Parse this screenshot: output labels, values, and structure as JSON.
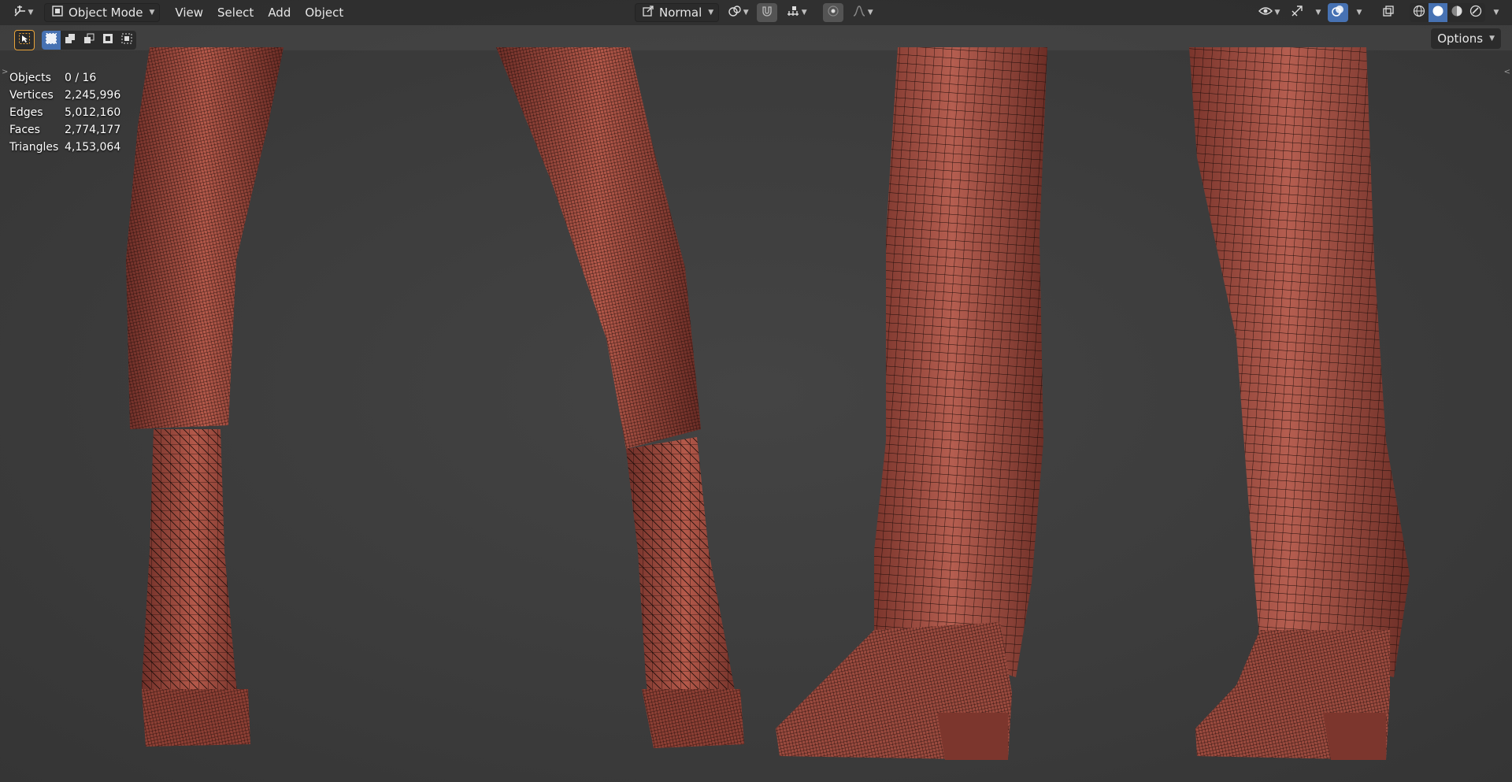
{
  "header": {
    "editor_type_icon": "axes-icon",
    "mode": "Object Mode",
    "menus": [
      "View",
      "Select",
      "Add",
      "Object"
    ],
    "transform_orientation": "Normal",
    "right_icons": [
      "visibility-icon",
      "gizmo-icon",
      "overlay-icon",
      "xray-icon",
      "wireframe-shading-icon",
      "solid-shading-icon",
      "material-shading-icon",
      "rendered-shading-icon"
    ]
  },
  "toolbar": {
    "options_label": "Options"
  },
  "stats": [
    {
      "label": "Objects",
      "value": "0 / 16"
    },
    {
      "label": "Vertices",
      "value": "2,245,996"
    },
    {
      "label": "Edges",
      "value": "5,012,160"
    },
    {
      "label": "Faces",
      "value": "2,774,177"
    },
    {
      "label": "Triangles",
      "value": "4,153,064"
    }
  ],
  "viewport": {
    "background": "#3d3d3d",
    "mesh_color": "#a34f42",
    "wire_color": "#1a0d0a"
  }
}
